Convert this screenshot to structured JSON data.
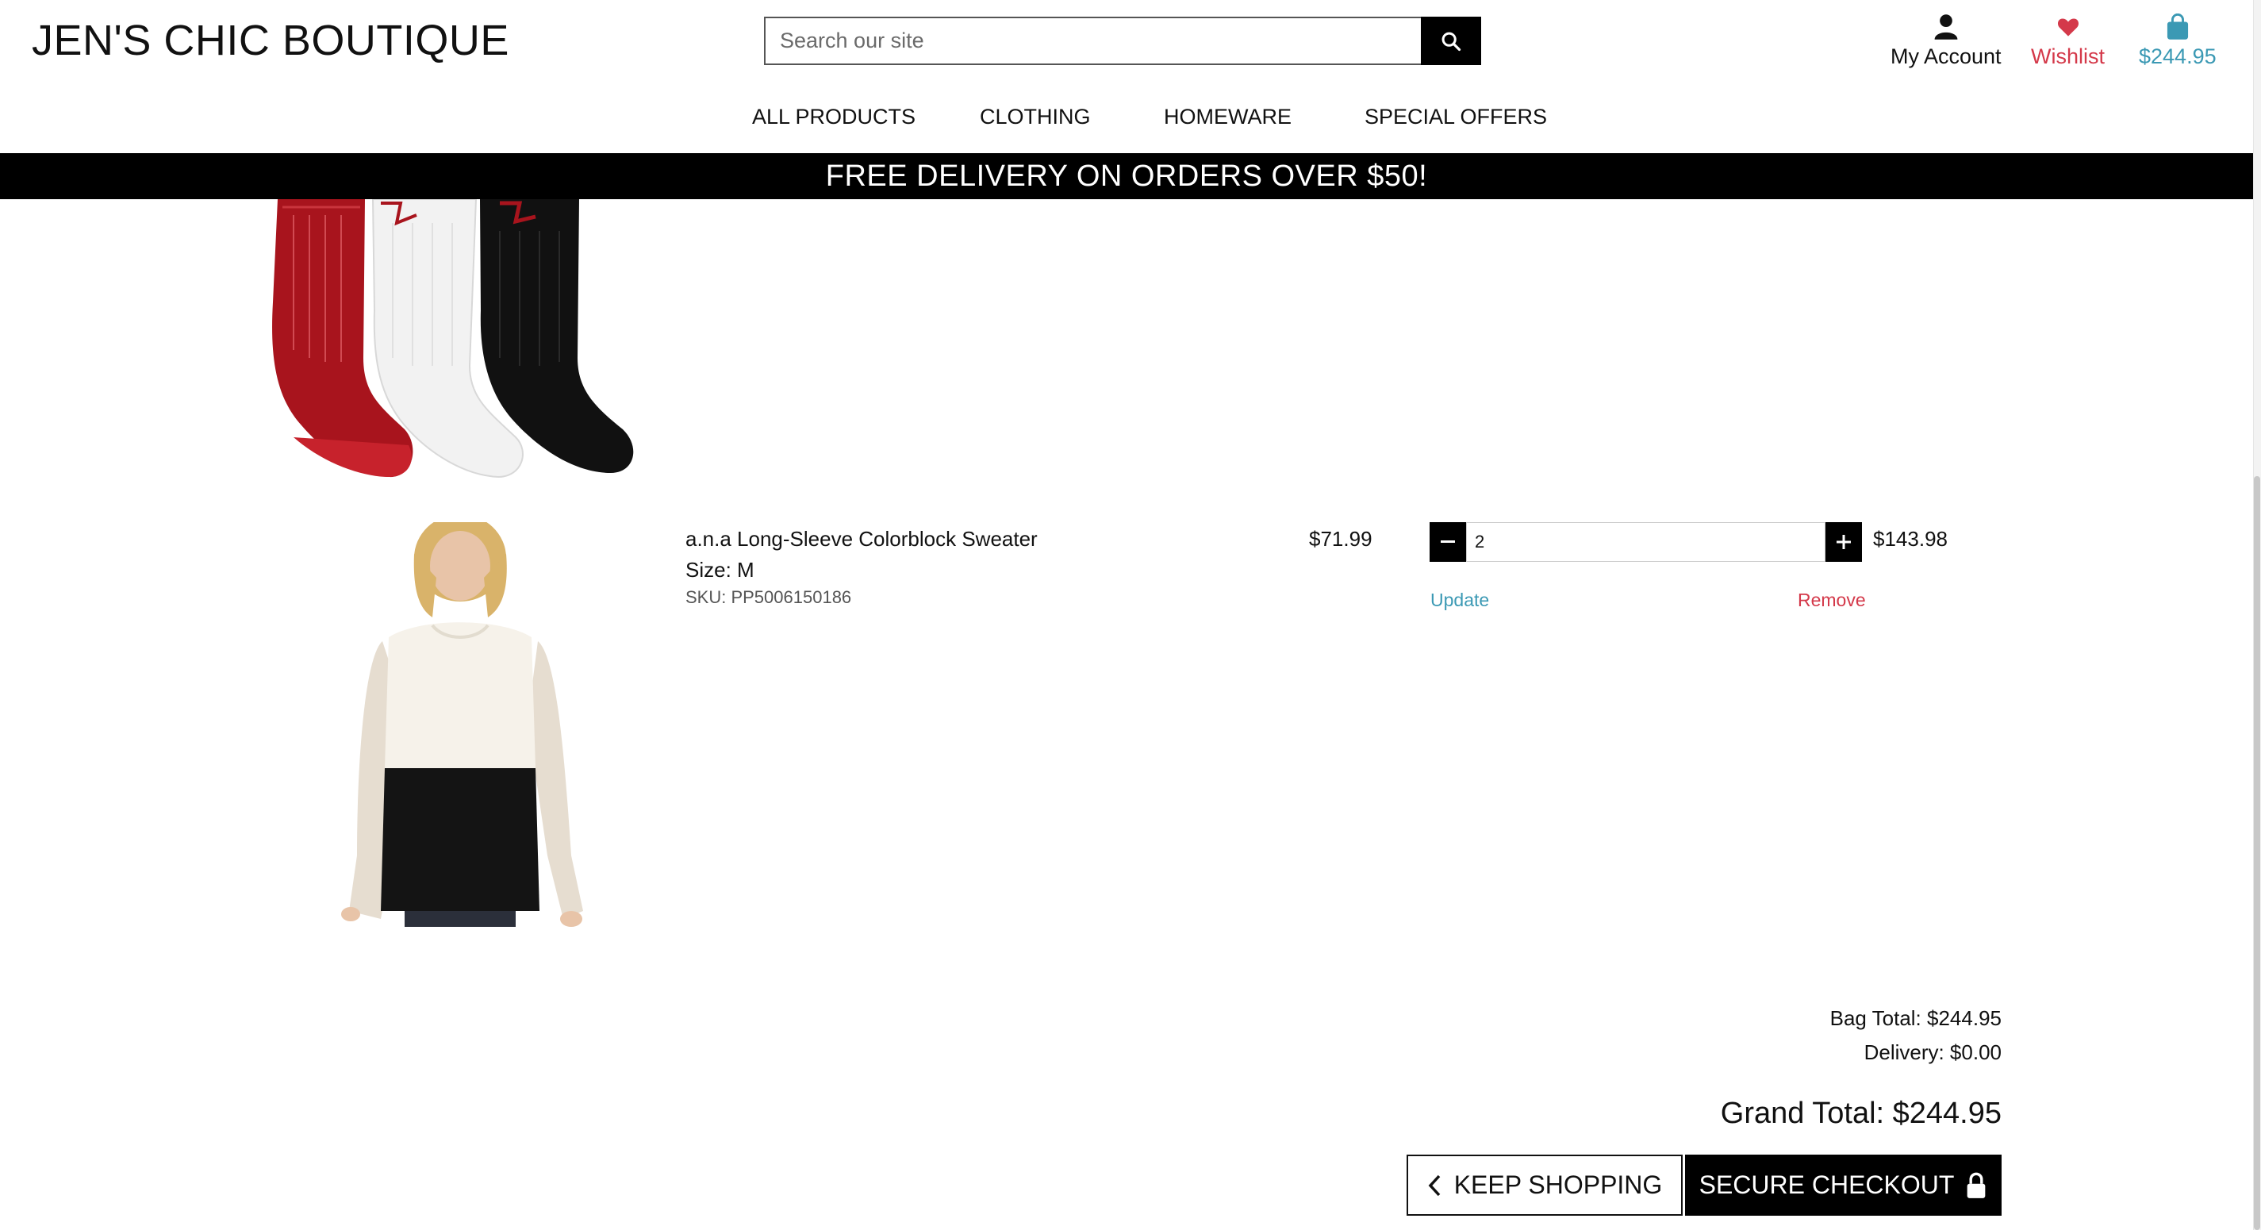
{
  "header": {
    "brand": "JEN'S CHIC BOUTIQUE",
    "search_placeholder": "Search our site",
    "account_label": "My Account",
    "wishlist_label": "Wishlist",
    "bag_label": "$244.95"
  },
  "nav": {
    "items": [
      "ALL PRODUCTS",
      "CLOTHING",
      "HOMEWARE",
      "SPECIAL OFFERS"
    ]
  },
  "banner": {
    "text": "FREE DELIVERY ON ORDERS OVER $50!"
  },
  "cart": {
    "items": [
      {
        "image": "socks-product-image"
      },
      {
        "image": "sweater-product-image",
        "name": "a.n.a Long-Sleeve Colorblock Sweater",
        "size": "Size: M",
        "sku": "SKU: PP5006150186",
        "price": "$71.99",
        "quantity": "2",
        "subtotal": "$143.98",
        "update_label": "Update",
        "remove_label": "Remove"
      }
    ]
  },
  "totals": {
    "bag_total": "Bag Total: $244.95",
    "delivery": "Delivery: $0.00",
    "grand_total": "Grand Total: $244.95"
  },
  "actions": {
    "keep_shopping": "KEEP SHOPPING",
    "secure_checkout": "SECURE CHECKOUT"
  },
  "colors": {
    "accent_blue": "#3b99b4",
    "accent_red": "#d4394a",
    "black": "#000000"
  }
}
